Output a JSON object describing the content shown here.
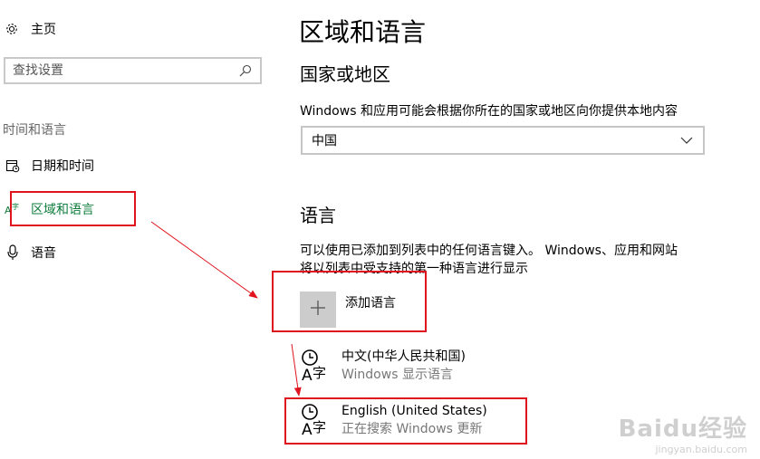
{
  "sidebar": {
    "home_label": "主页",
    "search_placeholder": "查找设置",
    "section_label": "时间和语言",
    "items": [
      {
        "label": "日期和时间",
        "icon": "calendar-clock-icon"
      },
      {
        "label": "区域和语言",
        "icon": "region-language-icon",
        "active": true
      },
      {
        "label": "语音",
        "icon": "microphone-icon"
      }
    ]
  },
  "main": {
    "title": "区域和语言",
    "country": {
      "heading": "国家或地区",
      "description": "Windows 和应用可能会根据你所在的国家或地区向你提供本地内容",
      "selected": "中国"
    },
    "language": {
      "heading": "语言",
      "description_line1": "可以使用已添加到列表中的任何语言键入。 Windows、应用和网站",
      "description_line2": "将以列表中受支持的第一种语言进行显示",
      "add_label": "添加语言",
      "languages": [
        {
          "name": "中文(中华人民共和国)",
          "status": "Windows 显示语言"
        },
        {
          "name": "English (United States)",
          "status": "正在搜索 Windows 更新"
        }
      ]
    }
  },
  "watermark": {
    "main": "Baidu经验",
    "sub": "jingyan.baidu.com"
  },
  "colors": {
    "accent": "#0f7d3c",
    "annotation": "#e0141e"
  }
}
